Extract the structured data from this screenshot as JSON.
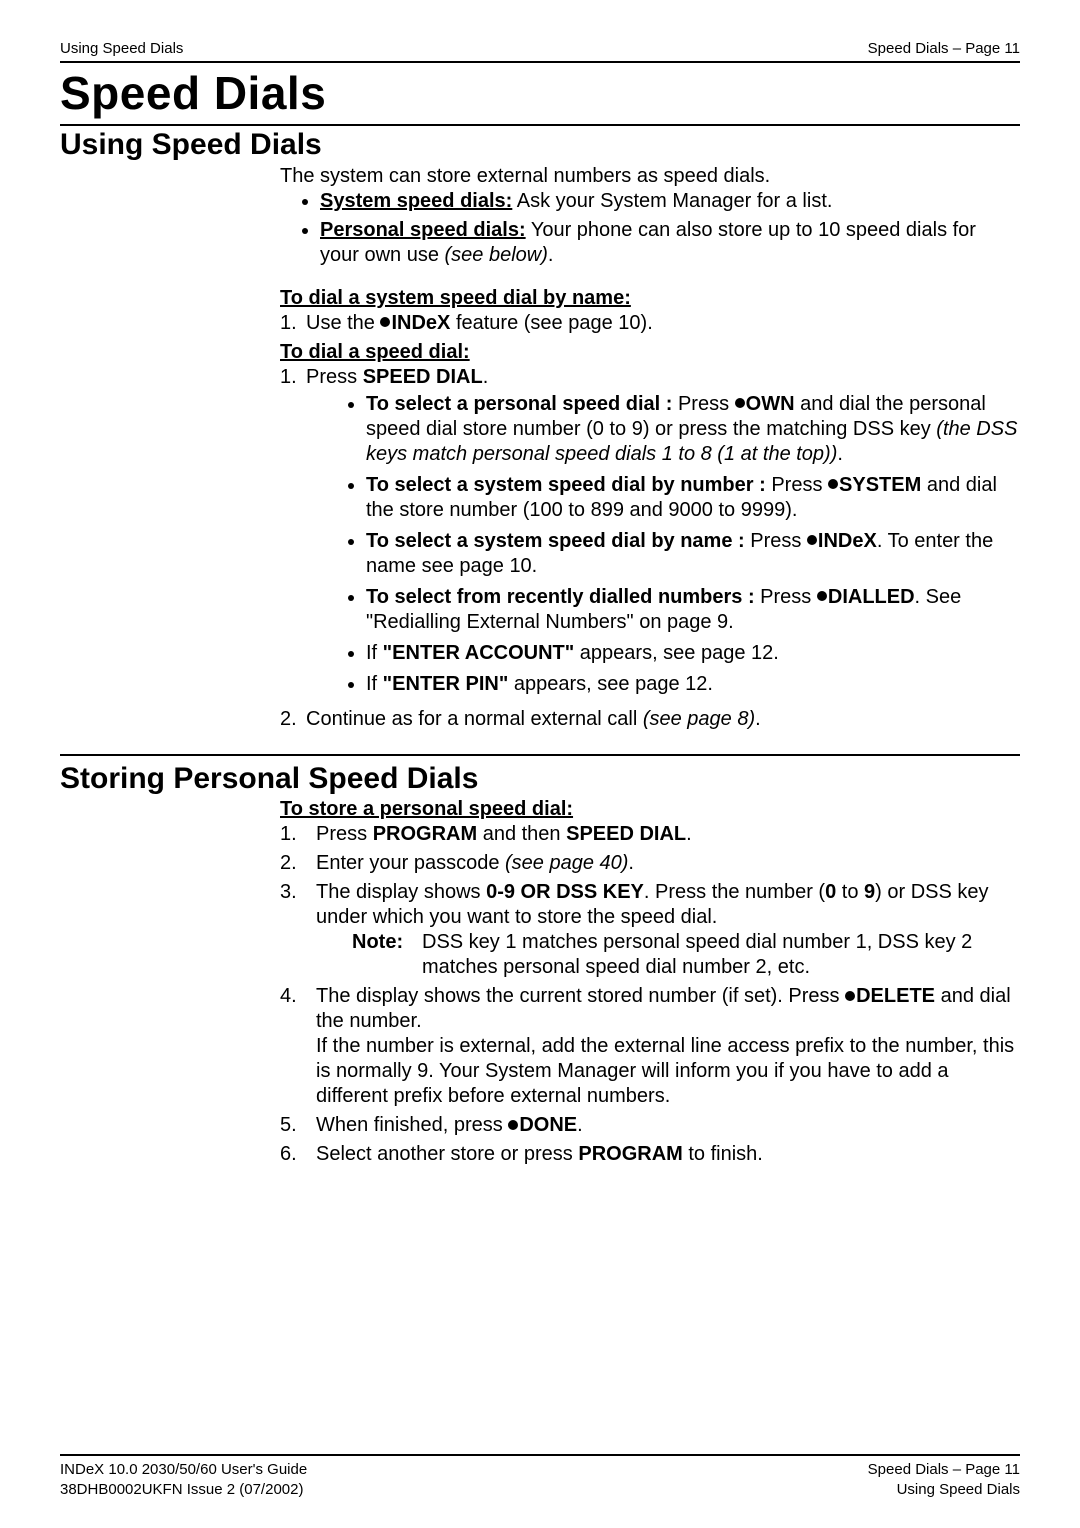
{
  "header": {
    "left": "Using Speed Dials",
    "right": "Speed Dials – Page 11"
  },
  "title": "Speed Dials",
  "section1": {
    "heading": "Using Speed Dials",
    "intro": "The system can store external numbers as speed dials.",
    "bullet1_label": "System speed dials:",
    "bullet1_text": " Ask your System Manager for a list.",
    "bullet2_label": "Personal speed dials:",
    "bullet2_text": " Your phone can also store up to 10 speed dials for your own use ",
    "bullet2_italic": "(see below)",
    "bullet2_tail": ".",
    "sub1_title": "To dial a system speed dial by name:",
    "sub1_line1_pre": "Use the ",
    "sub1_line1_btn": "INDeX",
    "sub1_line1_post": " feature (see page 10).",
    "sub2_title": "To dial a speed dial:",
    "sub2_line1_pre": "Press ",
    "sub2_line1_bold": "SPEED DIAL",
    "sub2_line1_tail": ".",
    "opt1_lead": "To select a personal speed dial :",
    "opt1_pre": " Press ",
    "opt1_btn": "OWN",
    "opt1_post": " and dial the personal speed dial store number (0 to 9) or press the matching DSS key ",
    "opt1_italic": "(the DSS keys match personal speed dials 1 to 8 (1 at the top))",
    "opt1_tail": ".",
    "opt2_lead": "To select a system speed dial by number :",
    "opt2_pre": " Press ",
    "opt2_btn": "SYSTEM",
    "opt2_post": " and dial the store number (100 to 899 and 9000 to 9999).",
    "opt3_lead": "To select a system speed dial by name :",
    "opt3_pre": " Press ",
    "opt3_btn": "INDeX",
    "opt3_post": ". To enter the name see page 10.",
    "opt4_lead": "To select from recently dialled numbers :",
    "opt4_pre": " Press ",
    "opt4_btn": "DIALLED",
    "opt4_post": ". See \"Redialling External Numbers\" on page 9.",
    "opt5_pre": "If ",
    "opt5_bold": "\"ENTER ACCOUNT\"",
    "opt5_post": " appears, see page 12.",
    "opt6_pre": "If ",
    "opt6_bold": "\"ENTER PIN\"",
    "opt6_post": " appears, see page 12.",
    "closing_pre": "Continue as for a normal external call ",
    "closing_italic": "(see page 8)",
    "closing_tail": "."
  },
  "section2": {
    "heading": "Storing Personal Speed Dials",
    "title": "To store a personal speed dial:",
    "s1_pre": "Press ",
    "s1_b1": "PROGRAM",
    "s1_mid": " and then ",
    "s1_b2": "SPEED DIAL",
    "s1_tail": ".",
    "s2_pre": "Enter your passcode ",
    "s2_italic": "(see page 40)",
    "s2_tail": ".",
    "s3_pre": "The display shows ",
    "s3_b1": "0-9 OR DSS KEY",
    "s3_mid1": ". Press the number (",
    "s3_b2": "0",
    "s3_mid2": " to ",
    "s3_b3": "9",
    "s3_mid3": ") or DSS key under which you want to store the speed dial.",
    "note_label": "Note:",
    "note_text": "DSS key 1 matches personal speed dial number 1, DSS key 2 matches personal speed dial number 2, etc.",
    "s4_pre": "The display shows the current stored number (if set). Press ",
    "s4_btn": "DELETE",
    "s4_post": " and dial the number.",
    "s4_para": "If the number is external, add the external line access prefix to the number, this is normally 9. Your System Manager will inform you if you have to add a different prefix before external numbers.",
    "s5_pre": "When finished, press ",
    "s5_btn": "DONE",
    "s5_tail": ".",
    "s6_pre": "Select another store or press ",
    "s6_b": "PROGRAM",
    "s6_post": " to finish."
  },
  "footer": {
    "left1": "INDeX 10.0 2030/50/60 User's Guide",
    "left2": "38DHB0002UKFN Issue 2 (07/2002)",
    "right1": "Speed Dials – Page 11",
    "right2": "Using Speed Dials"
  }
}
